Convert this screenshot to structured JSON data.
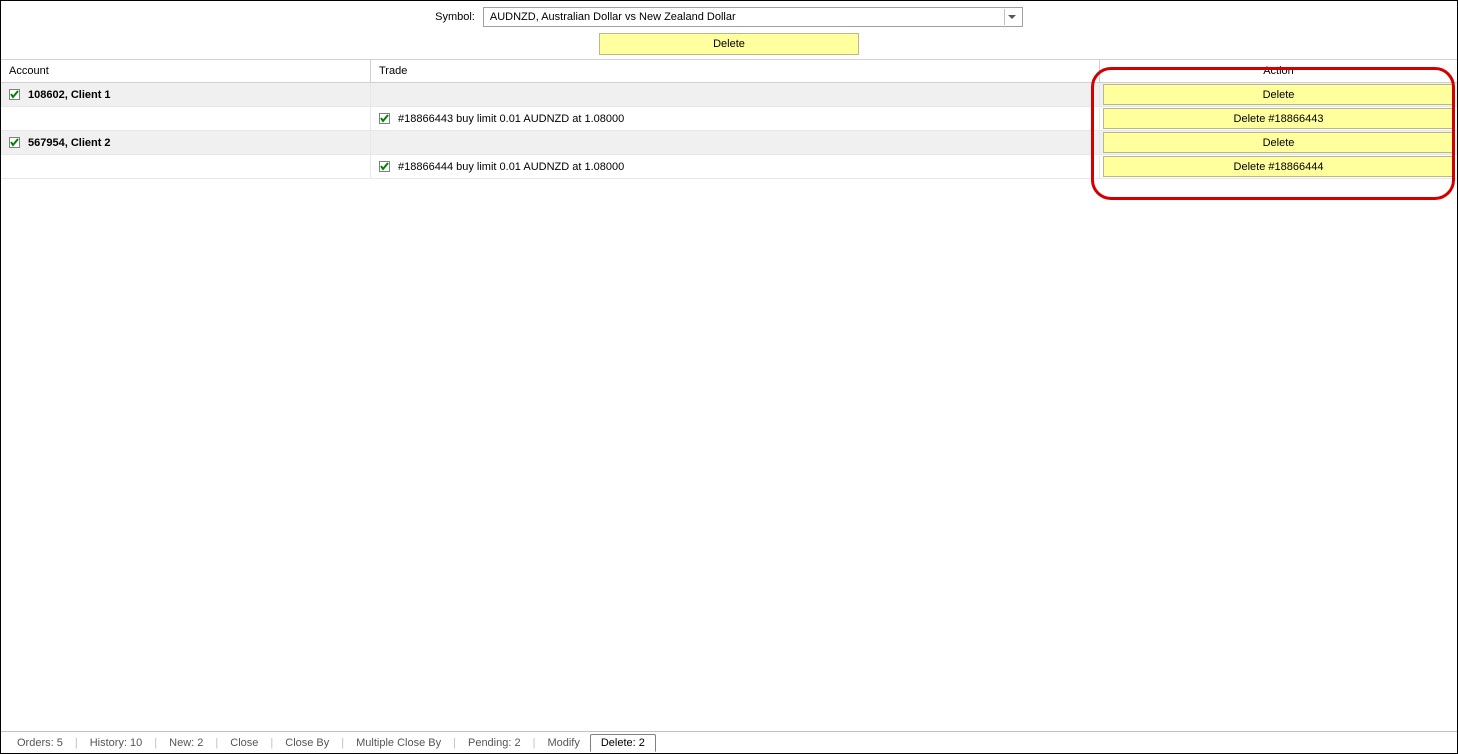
{
  "symbol": {
    "label": "Symbol:",
    "value": "AUDNZD, Australian Dollar vs New Zealand Dollar"
  },
  "main_button": {
    "label": "Delete"
  },
  "columns": {
    "account": "Account",
    "trade": "Trade",
    "action": "Action"
  },
  "rows": [
    {
      "type": "account",
      "account": "108602, Client 1",
      "trade": "",
      "action_label": "Delete"
    },
    {
      "type": "trade",
      "account": "",
      "trade": "#18866443 buy limit 0.01 AUDNZD at 1.08000",
      "action_label": "Delete #18866443"
    },
    {
      "type": "account",
      "account": "567954, Client 2",
      "trade": "",
      "action_label": "Delete"
    },
    {
      "type": "trade",
      "account": "",
      "trade": "#18866444 buy limit 0.01 AUDNZD at 1.08000",
      "action_label": "Delete #18866444"
    }
  ],
  "tabs": [
    {
      "label": "Orders: 5",
      "active": false
    },
    {
      "label": "History: 10",
      "active": false
    },
    {
      "label": "New: 2",
      "active": false
    },
    {
      "label": "Close",
      "active": false
    },
    {
      "label": "Close By",
      "active": false
    },
    {
      "label": "Multiple Close By",
      "active": false
    },
    {
      "label": "Pending: 2",
      "active": false
    },
    {
      "label": "Modify",
      "active": false
    },
    {
      "label": "Delete: 2",
      "active": true
    }
  ]
}
